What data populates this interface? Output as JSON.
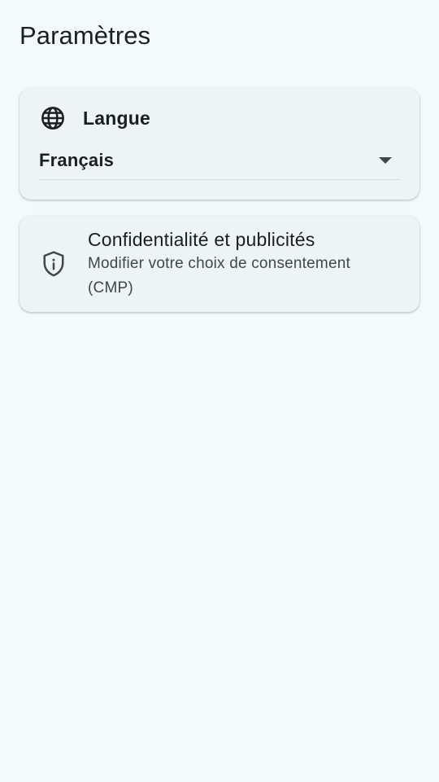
{
  "header": {
    "title": "Paramètres"
  },
  "language": {
    "icon": "globe-icon",
    "title": "Langue",
    "selected": "Français"
  },
  "privacy": {
    "icon": "shield-info-icon",
    "title": "Confidentialité et publicités",
    "subtitle": "Modifier votre choix de consentement (CMP)"
  },
  "colors": {
    "background": "#f3fbfa",
    "card": "#eef3f3",
    "text": "#1b1f1f",
    "secondary_text": "#3f4948"
  }
}
